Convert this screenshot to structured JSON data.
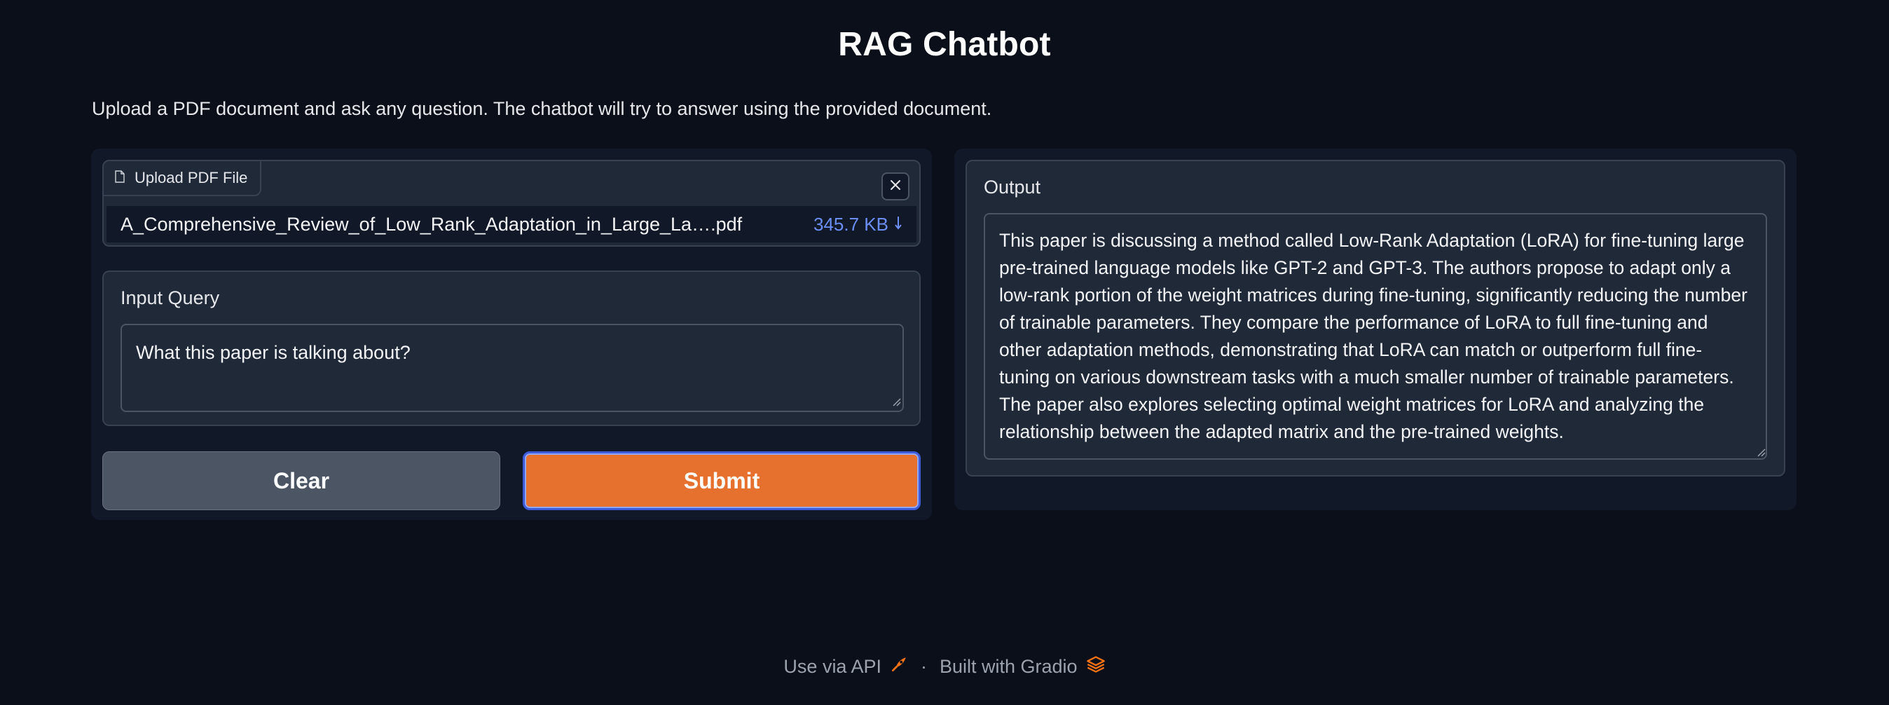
{
  "header": {
    "title": "RAG Chatbot",
    "description": "Upload a PDF document and ask any question. The chatbot will try to answer using the provided document."
  },
  "upload": {
    "label": "Upload PDF File",
    "file_name": "A_Comprehensive_Review_of_Low_Rank_Adaptation_in_Large_La….pdf",
    "file_size": "345.7 KB",
    "download_icon": "download-arrow-icon",
    "clear_icon": "close-icon"
  },
  "query": {
    "label": "Input Query",
    "value": "What this paper is talking about?"
  },
  "buttons": {
    "clear_label": "Clear",
    "submit_label": "Submit"
  },
  "output": {
    "label": "Output",
    "text": " This paper is discussing a method called Low-Rank Adaptation (LoRA) for fine-tuning large pre-trained language models like GPT-2 and GPT-3. The authors propose to adapt only a low-rank portion of the weight matrices during fine-tuning, significantly reducing the number of trainable parameters. They compare the performance of LoRA to full fine-tuning and other adaptation methods, demonstrating that LoRA can match or outperform full fine-tuning on various downstream tasks with a much smaller number of trainable parameters. The paper also explores selecting optimal weight matrices for LoRA and analyzing the relationship between the adapted matrix and the pre-trained weights."
  },
  "footer": {
    "api_label": "Use via API",
    "separator": "·",
    "built_label": "Built with Gradio"
  },
  "colors": {
    "background": "#0b0f19",
    "submit": "#e6702e",
    "file_size": "#6b8ef7",
    "accent_icon": "#f97316"
  }
}
